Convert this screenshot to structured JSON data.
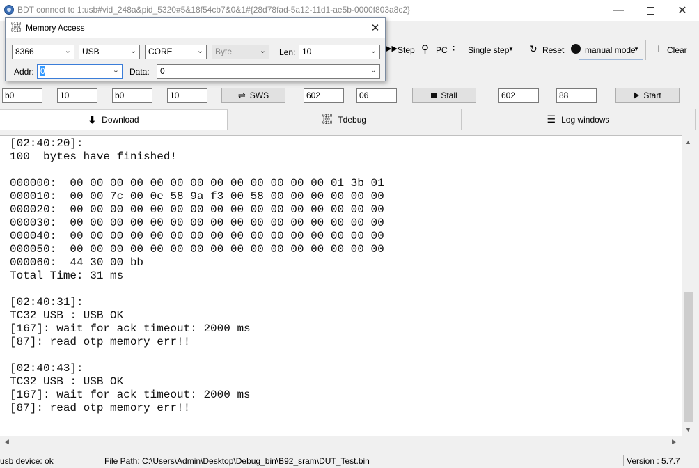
{
  "window": {
    "title": "BDT connect to 1:usb#vid_248a&pid_5320#5&18f54cb7&0&1#{28d78fad-5a12-11d1-ae5b-0000f803a8c2}"
  },
  "toolbar": {
    "step_label": "Step",
    "pc_label": "PC",
    "single_step_label": "Single step",
    "reset_label": "Reset",
    "manual_mode_label": "manual mode",
    "clear_label": "Clear"
  },
  "fields_row": {
    "f1": "b0",
    "f2": "10",
    "f3": "b0",
    "f4": "10",
    "sws_label": "SWS",
    "f5": "602",
    "f6": "06",
    "stall_label": "Stall",
    "f7": "602",
    "f8": "88",
    "start_label": "Start"
  },
  "tabs": {
    "download": "Download",
    "tdebug": "Tdebug",
    "log_windows": "Log windows"
  },
  "log": {
    "lines": [
      "[02:40:20]:",
      "100  bytes have finished!",
      "",
      "000000:  00 00 00 00 00 00 00 00 00 00 00 00 00 01 3b 01",
      "000010:  00 00 7c 00 0e 58 9a f3 00 58 00 00 00 00 00 00",
      "000020:  00 00 00 00 00 00 00 00 00 00 00 00 00 00 00 00",
      "000030:  00 00 00 00 00 00 00 00 00 00 00 00 00 00 00 00",
      "000040:  00 00 00 00 00 00 00 00 00 00 00 00 00 00 00 00",
      "000050:  00 00 00 00 00 00 00 00 00 00 00 00 00 00 00 00",
      "000060:  44 30 00 bb",
      "Total Time: 31 ms",
      "",
      "[02:40:31]:",
      "TC32 USB : USB OK",
      "[167]: wait for ack timeout: 2000 ms",
      "[87]: read otp memory err!!",
      "",
      "[02:40:43]:",
      "TC32 USB : USB OK",
      "[167]: wait for ack timeout: 2000 ms",
      "[87]: read otp memory err!!"
    ]
  },
  "statusbar": {
    "device": "usb device: ok",
    "file_path": "File Path:  C:\\Users\\Admin\\Desktop\\Debug_bin\\B92_sram\\DUT_Test.bin",
    "version": "Version : 5.7.7"
  },
  "dialog": {
    "title": "Memory Access",
    "chip": "8366",
    "interface": "USB",
    "target": "CORE",
    "unit": "Byte",
    "len_label": "Len:",
    "len_value": "10",
    "addr_label": "Addr:",
    "addr_value": "0",
    "data_label": "Data:",
    "data_value": "0"
  }
}
